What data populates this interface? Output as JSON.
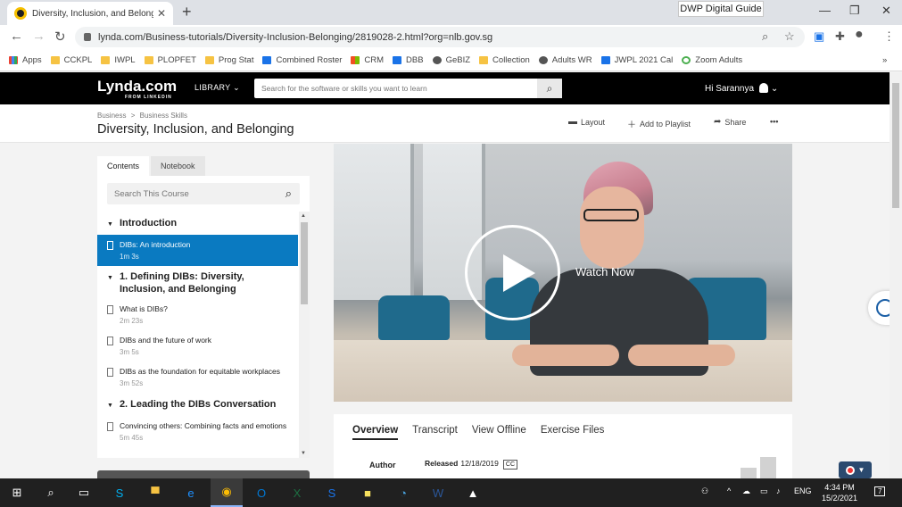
{
  "browser": {
    "tab_title": "Diversity, Inclusion, and Belongin",
    "url": "lynda.com/Business-tutorials/Diversity-Inclusion-Belonging/2819028-2.html?org=nlb.gov.sg",
    "extension_label": "DWP Digital Guide",
    "bookmarks": [
      "Apps",
      "CCKPL",
      "IWPL",
      "PLOPFET",
      "Prog Stat",
      "Combined Roster",
      "CRM",
      "DBB",
      "GeBIZ",
      "Collection",
      "Adults WR",
      "JWPL 2021 Cal",
      "Zoom Adults"
    ],
    "bookmark_more": "»"
  },
  "site": {
    "logo": "Lynda.com",
    "logo_sub": "FROM LINKEDIN",
    "library_label": "LIBRARY",
    "search_placeholder": "Search for the software or skills you want to learn",
    "greeting": "Hi Sarannya"
  },
  "course": {
    "breadcrumb_1": "Business",
    "breadcrumb_sep": ">",
    "breadcrumb_2": "Business Skills",
    "title": "Diversity, Inclusion, and Belonging",
    "actions": {
      "layout": "Layout",
      "add_playlist": "Add to Playlist",
      "share": "Share",
      "more": "•••"
    }
  },
  "panel": {
    "tabs": [
      "Contents",
      "Notebook"
    ],
    "search_placeholder": "Search This Course",
    "toc": [
      {
        "type": "chapter",
        "title": "Introduction"
      },
      {
        "type": "video",
        "title": "DIBs: An introduction",
        "duration": "1m 3s",
        "active": true
      },
      {
        "type": "chapter",
        "title": "1. Defining DIBs: Diversity, Inclusion, and Belonging"
      },
      {
        "type": "video",
        "title": "What is DIBs?",
        "duration": "2m 23s"
      },
      {
        "type": "video",
        "title": "DIBs and the future of work",
        "duration": "3m 5s"
      },
      {
        "type": "video",
        "title": "DIBs as the foundation for equitable workplaces",
        "duration": "3m 52s"
      },
      {
        "type": "chapter",
        "title": "2. Leading the DIBs Conversation"
      },
      {
        "type": "video",
        "title": "Convincing others: Combining facts and emotions",
        "duration": "5m 45s"
      }
    ]
  },
  "video": {
    "watch_label": "Watch Now"
  },
  "details": {
    "tabs": [
      "Overview",
      "Transcript",
      "View Offline",
      "Exercise Files"
    ],
    "author_label": "Author",
    "released_label": "Released",
    "released_date": "12/18/2019",
    "cc_label": "CC"
  },
  "taskbar": {
    "lang": "ENG",
    "time": "4:34 PM",
    "date": "15/2/2021",
    "notifications": "7"
  }
}
